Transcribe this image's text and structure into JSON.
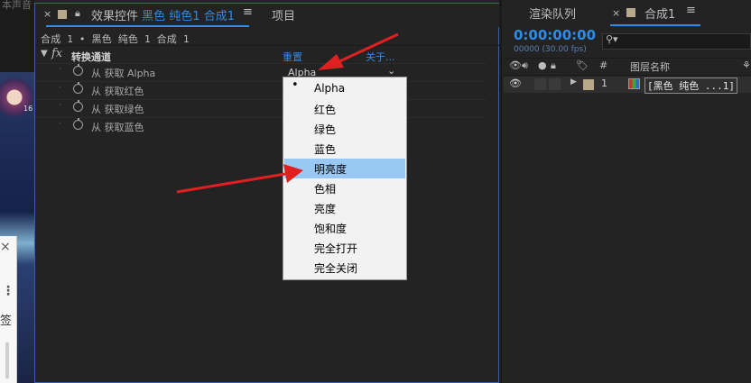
{
  "left_strip": {
    "top_text": "本声音",
    "badge_text": "16",
    "panel_tag": "签"
  },
  "effect_controls": {
    "tab": {
      "close": "×",
      "title_prefix": "效果控件",
      "title_layer": "黑色 纯色1",
      "title_comp": "合成1",
      "menu": "≡",
      "project_tab": "项目"
    },
    "breadcrumb": "合成 1 • 黑色 纯色 1 合成 1",
    "effect": {
      "twirl": "▼",
      "fx_icon": "fx",
      "name": "转换通道",
      "reset_label": "重置",
      "about_label": "关于..."
    },
    "properties": [
      {
        "label": "从 获取 Alpha",
        "value": "Alpha"
      },
      {
        "label": "从 获取红色",
        "value": ""
      },
      {
        "label": "从 获取绿色",
        "value": ""
      },
      {
        "label": "从 获取蓝色",
        "value": ""
      }
    ]
  },
  "dropdown_menu": {
    "items": [
      "Alpha",
      "红色",
      "绿色",
      "蓝色",
      "明亮度",
      "色相",
      "亮度",
      "饱和度",
      "完全打开",
      "完全关闭"
    ],
    "checked": "Alpha",
    "highlighted": "明亮度"
  },
  "composition": {
    "render_queue_tab": "渲染队列",
    "comp_tab": "合成1",
    "comp_menu": "≡",
    "timecode": "0:00:00:00",
    "fps": "00000 (30.00 fps)",
    "search_icon": "search-icon",
    "columns": {
      "number": "#",
      "layer_name": "图层名称"
    },
    "layers": [
      {
        "number": "1",
        "name": "[黑色 纯色 ...1]"
      }
    ]
  },
  "colors": {
    "accent": "#2d8ceb",
    "menu_highlight": "#99c8f4",
    "label_swatch": "#b7a98a",
    "annotation_arrow": "#e02020"
  }
}
